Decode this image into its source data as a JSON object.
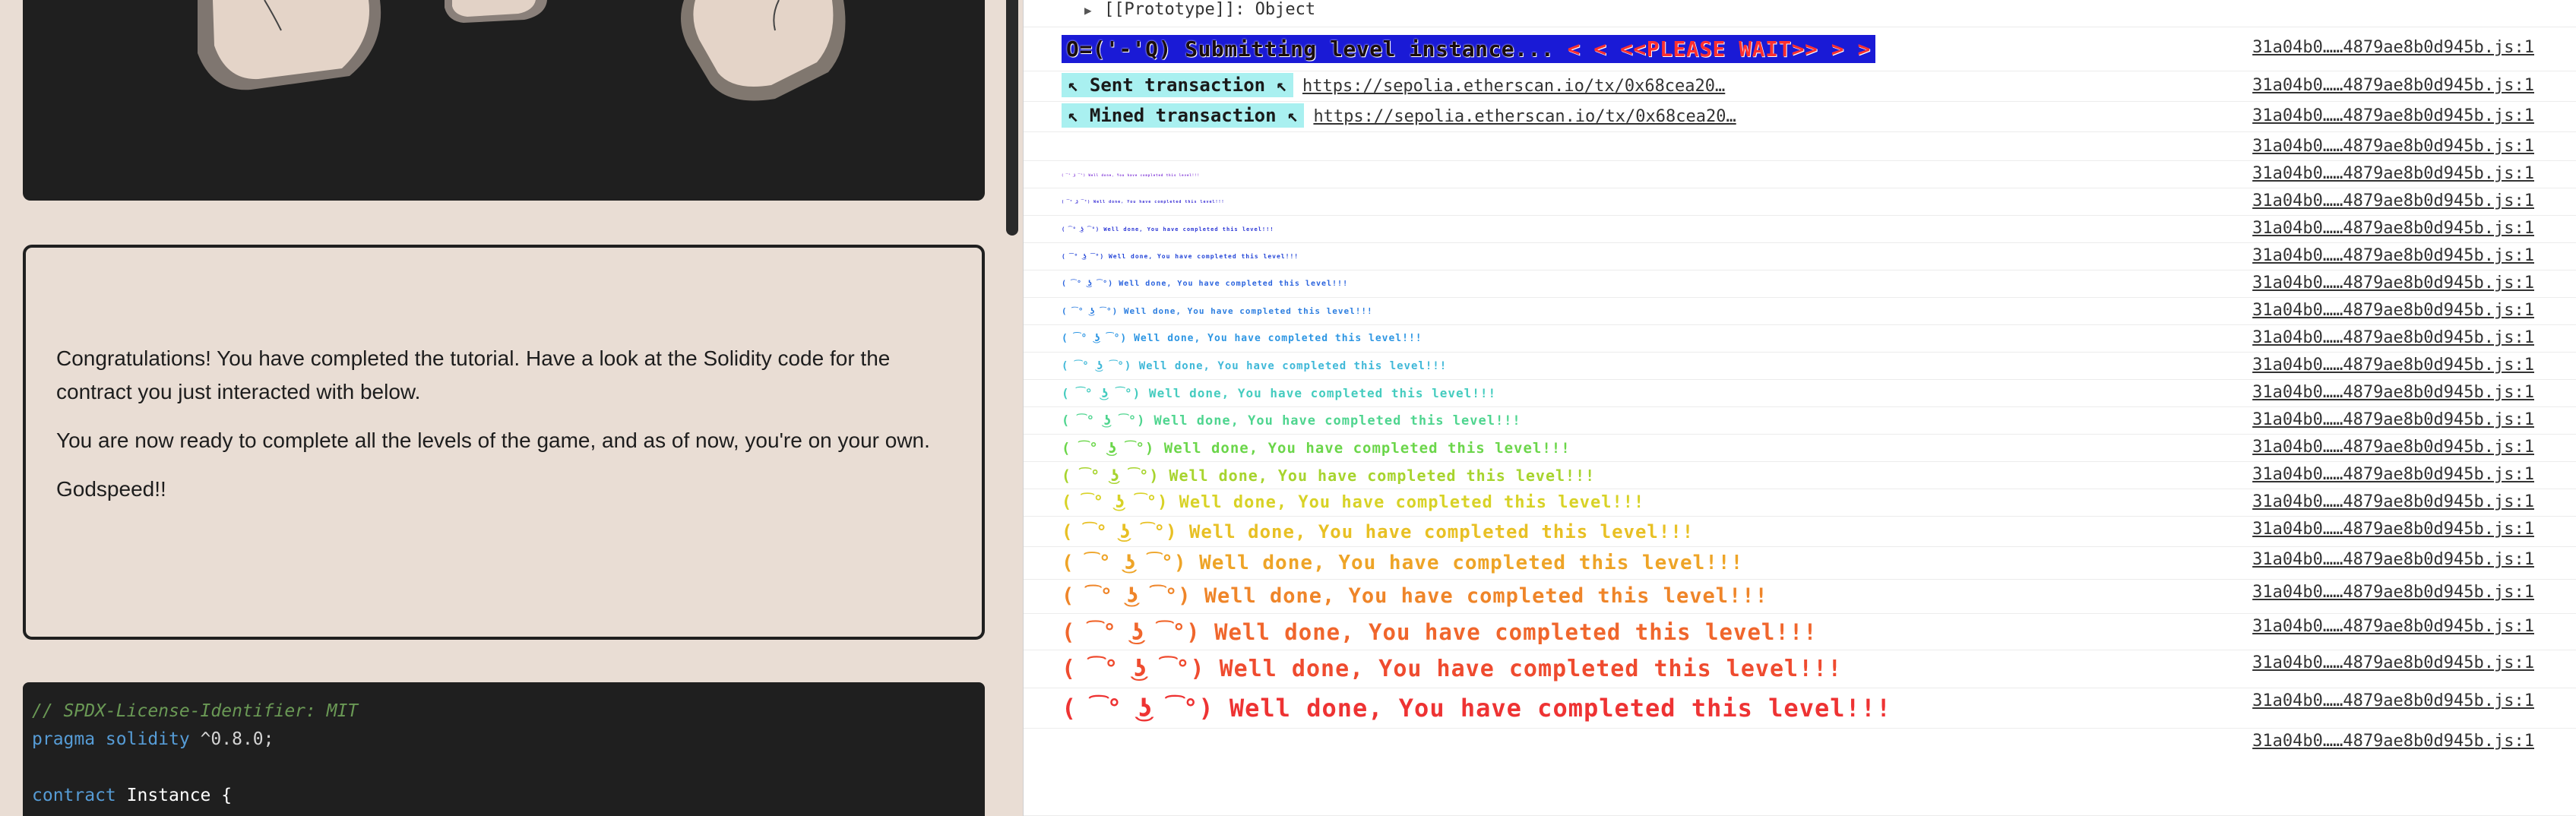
{
  "game": {
    "message_paragraphs": [
      "Congratulations! You have completed the tutorial. Have a look at the Solidity code for the contract you just interacted with below.",
      "You are now ready to complete all the levels of the game, and as of now, you're on your own.",
      "Godspeed!!"
    ],
    "code": {
      "line1_comment": "// SPDX-License-Identifier: MIT",
      "line2_kw": "pragma solidity",
      "line2_rest": " ^0.8.0;",
      "line4_kw": "contract",
      "line4_rest": " Instance {"
    }
  },
  "console": {
    "prototype_label": "[[Prototype]]: Object",
    "submitting_text": "O=('-'Q) Submitting level instance...",
    "please_wait_text": " <  < <<PLEASE WAIT>> >  >",
    "sent_label": "↖ Sent transaction ↖",
    "sent_url": "https://sepolia.etherscan.io/tx/0x68cea20…",
    "mined_label": "↖ Mined transaction ↖",
    "mined_url": "https://sepolia.etherscan.io/tx/0x68cea20…",
    "source_link": "31a04b0……4879ae8b0d945b.js:1",
    "celebration_text": "( ͡° ͜ʖ ͡°) Well done, You have completed this level!!!",
    "celebration_colors": [
      "#7b2fd6",
      "#3a2fd6",
      "#2a36d6",
      "#2446d8",
      "#2a63de",
      "#2c7ee0",
      "#2d96e3",
      "#3fb8d8",
      "#45ccbf",
      "#4fd58f",
      "#6bd64a",
      "#a7d42e",
      "#d8d226",
      "#e8c024",
      "#eea427",
      "#ef8529",
      "#f0662c",
      "#ef4b2f",
      "#ee3333"
    ]
  },
  "colors": {
    "page_bg": "#e9ddd4",
    "panel_dark": "#1f1f1f",
    "submit_bg": "#1a1ad6",
    "submit_fg": "#ff3030",
    "tx_badge_bg": "#a9f0f0"
  }
}
